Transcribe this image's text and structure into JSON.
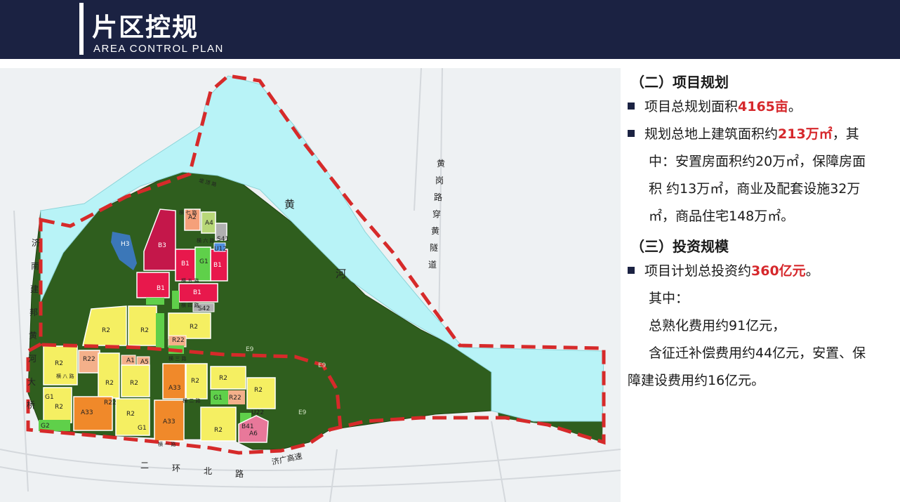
{
  "header": {
    "title": "片区控规",
    "subtitle": "AREA CONTROL PLAN"
  },
  "colors": {
    "header_bg": "#1b2242",
    "highlight": "#d6282c",
    "river": "#b8f3f7",
    "green_space": "#2f5e1e",
    "residential": "#f5ef62",
    "commercial": "#e0184a",
    "education": "#f0892a",
    "park": "#5fd04a",
    "boundary": "#d62a2a"
  },
  "map": {
    "labels": {
      "river_char_1": "黄",
      "river_char_2": "河",
      "tunnel": [
        "黄",
        "岗",
        "路",
        "穿",
        "黄",
        "隧",
        "道"
      ],
      "jinan_road": [
        "济",
        "南",
        "建",
        "邦",
        "黄",
        "河",
        "大",
        "桥"
      ],
      "jiguang_expressway": "济广高速",
      "erhuan_road": [
        "二",
        "环",
        "北",
        "路"
      ],
      "dike_road": "堤 顶 路",
      "heng_qi": "横 七 路",
      "heng_liu": "横 六 路",
      "heng_wu": "横 五 路",
      "heng_si": "横 四 路",
      "heng_san": "横 三 路",
      "heng_er": "横 二 路",
      "heng_yi": "横 一 路",
      "heng_ba": "横 八 路",
      "zong_qi": "纵 七 路",
      "zong_liu": "纵 六 路",
      "zong_wu": "纵 五 路",
      "zong_yi": "纵 一 路"
    },
    "parcels": {
      "B1": "B1",
      "B3": "B3",
      "A2": "A2",
      "A4": "A4",
      "S41": "S41",
      "U12": "U12",
      "S42": "S42",
      "H3": "H3",
      "G1": "G1",
      "G2": "G2",
      "R2": "R2",
      "R22": "R22",
      "A1": "A1",
      "A5": "A5",
      "A33": "A33",
      "U22": "U22",
      "B41": "B41",
      "A6": "A6",
      "E9": "E9"
    }
  },
  "panel": {
    "section2_heading": "（二）项目规划",
    "item1_prefix": "项目总规划面积",
    "item1_value": "4165亩",
    "item1_suffix": "。",
    "item2_prefix": "规划总地上建筑面积约",
    "item2_value": "213万㎡",
    "item2_suffix": "，其",
    "item2_line2": "中：安置房面积约20万㎡，保障房面",
    "item2_line3": "积  约13万㎡，商业及配套设施32万",
    "item2_line4": "㎡，商品住宅148万㎡。",
    "section3_heading": "（三）投资规模",
    "item3_prefix": "项目计划总投资约",
    "item3_value": "360亿元",
    "item3_suffix": "。",
    "item3_line2": "其中：",
    "item3_line3": "总熟化费用约91亿元，",
    "item3_line4": "含征迁补偿费用约44亿元，安置、保",
    "item3_line5": "障建设费用约16亿元。"
  }
}
